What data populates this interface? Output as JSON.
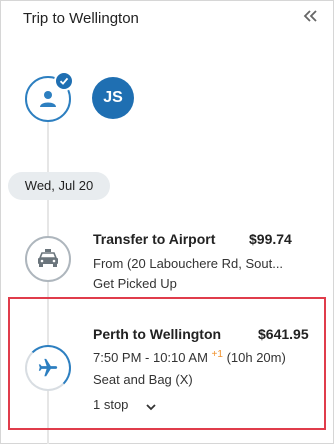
{
  "header": {
    "title": "Trip to Wellington",
    "collapse_icon": "chevron-double-left-icon"
  },
  "traveler": {
    "initials": "JS",
    "avatar_icon": "person-icon",
    "badge_icon": "checkmark-icon"
  },
  "date": {
    "label": "Wed, Jul 20"
  },
  "segments": [
    {
      "icon": "car-icon",
      "title": "Transfer to Airport",
      "price": "$99.74",
      "line1": "From (20 Labouchere Rd, Sout...",
      "line2": "Get Picked Up"
    },
    {
      "icon": "airplane-icon",
      "title": "Perth to Wellington",
      "price": "$641.95",
      "time": "7:50 PM - 10:10 AM",
      "day_offset": "+1",
      "duration": "(10h 20m)",
      "fare": "Seat and Bag (X)",
      "stops": "1 stop",
      "stops_icon": "chevron-down-icon",
      "selected": true
    }
  ],
  "colors": {
    "accent": "#1f6fb2",
    "selection": "#e03c4b",
    "day_offset": "#f0902a"
  }
}
